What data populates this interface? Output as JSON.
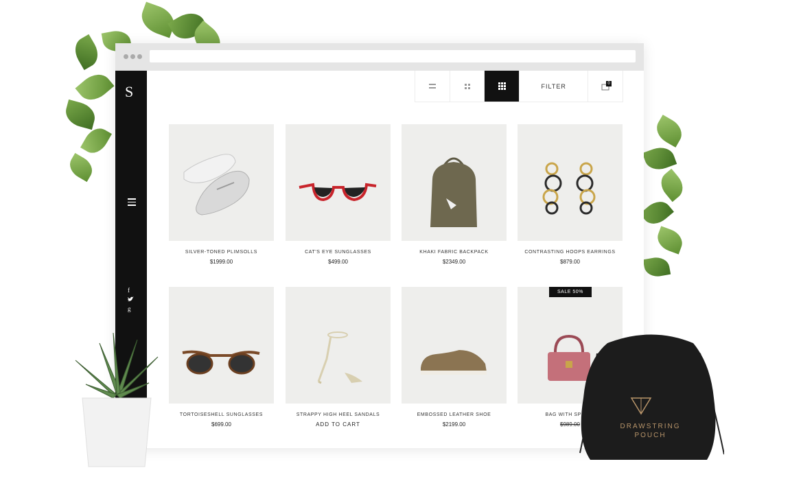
{
  "sidebar": {
    "logo": "S",
    "social": [
      "f",
      "t",
      "g"
    ]
  },
  "toolbar": {
    "view_list_icon": "list-view-icon",
    "view_grid_small_icon": "grid-2-view-icon",
    "view_grid_active_icon": "grid-3-view-icon",
    "filter_label": "FILTER",
    "cart_count": "0"
  },
  "products": [
    {
      "name": "SILVER-TONED PLIMSOLLS",
      "price": "$1999.00"
    },
    {
      "name": "CAT'S EYE SUNGLASSES",
      "price": "$499.00"
    },
    {
      "name": "KHAKI FABRIC BACKPACK",
      "price": "$2349.00"
    },
    {
      "name": "CONTRASTING HOOPS EARRINGS",
      "price": "$879.00"
    },
    {
      "name": "TORTOISESHELL SUNGLASSES",
      "price": "$699.00"
    },
    {
      "name": "STRAPPY HIGH HEEL SANDALS",
      "action": "ADD TO CART"
    },
    {
      "name": "EMBOSSED LEATHER SHOE",
      "price": "$2199.00"
    },
    {
      "name": "BAG WITH SPLIT S",
      "old_price": "$989.00",
      "badge": "SALE 50%"
    }
  ],
  "pouch": {
    "line1": "DRAWSTRING",
    "line2": "POUCH"
  },
  "colors": {
    "sidebar": "#111111",
    "tile_bg": "#eeeeec",
    "pouch": "#1a1a1a",
    "pouch_text": "#b8956a"
  }
}
